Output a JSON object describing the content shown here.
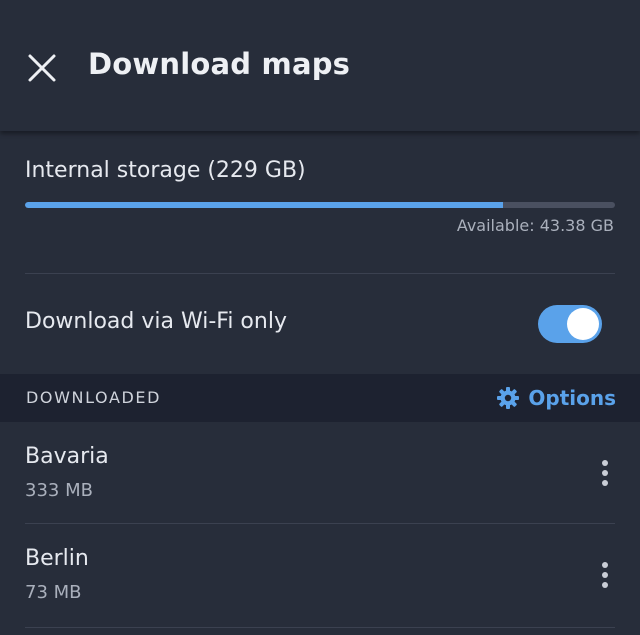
{
  "header": {
    "title": "Download maps",
    "close_icon": "close-icon"
  },
  "storage": {
    "title": "Internal storage (229 GB)",
    "used_fraction": 0.81,
    "available": "Available: 43.38 GB",
    "bar_color": "#5aa2ea"
  },
  "wifi": {
    "label": "Download via Wi-Fi only",
    "enabled": true
  },
  "downloaded_section": {
    "title": "DOWNLOADED",
    "options_label": "Options",
    "options_icon": "gear-icon"
  },
  "maps": [
    {
      "name": "Bavaria",
      "size": "333 MB"
    },
    {
      "name": "Berlin",
      "size": "73 MB"
    }
  ],
  "colors": {
    "background": "#272d3a",
    "accent": "#5aa2ea",
    "section_header": "#1d2230"
  }
}
